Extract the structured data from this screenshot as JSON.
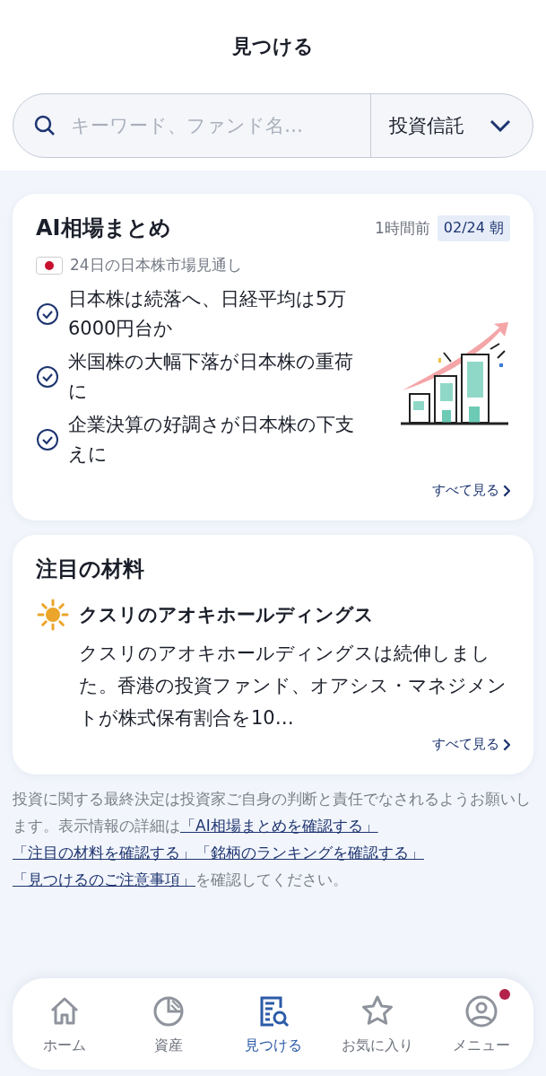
{
  "header": {
    "title": "見つける"
  },
  "search": {
    "placeholder": "キーワード、ファンド名…",
    "category": "投資信託"
  },
  "summary": {
    "title": "AI相場まとめ",
    "time": "1時間前",
    "date": "02/24 朝",
    "market": "24日の日本株市場見通し",
    "points": [
      "日本株は続落へ、日経平均は5万6000円台か",
      "米国株の大幅下落が日本株の重荷に",
      "企業決算の好調さが日本株の下支えに"
    ],
    "more": "すべて見る"
  },
  "materials": {
    "title": "注目の材料",
    "stock": "クスリのアオキホールディングス",
    "body": "クスリのアオキホールディングスは続伸しました。香港の投資ファンド、オアシス・マネジメントが株式保有割合を10…",
    "more": "すべて見る"
  },
  "disclaimer": [
    {
      "text": "投資に関する最終決定は投資家ご自身の判断と責任でなされるようお願いします。表示情報の詳細は",
      "link": false
    },
    {
      "text": "「AI相場まとめを確認する」",
      "link": true
    },
    {
      "text": "「注目の材料を確認する」",
      "link": true
    },
    {
      "text": "「銘柄のランキングを確認する」",
      "link": true
    },
    {
      "text": "「見つけるのご注意事項」",
      "link": true
    },
    {
      "text": "を確認してください。",
      "link": false
    }
  ],
  "nav": [
    {
      "label": "ホーム",
      "kind": "home",
      "selected": false,
      "notification": false
    },
    {
      "label": "資産",
      "kind": "assets",
      "selected": false,
      "notification": false
    },
    {
      "label": "見つける",
      "kind": "discover",
      "selected": true,
      "notification": false
    },
    {
      "label": "お気に入り",
      "kind": "favorite",
      "selected": false,
      "notification": false
    },
    {
      "label": "メニュー",
      "kind": "menu",
      "selected": false,
      "notification": true
    }
  ]
}
